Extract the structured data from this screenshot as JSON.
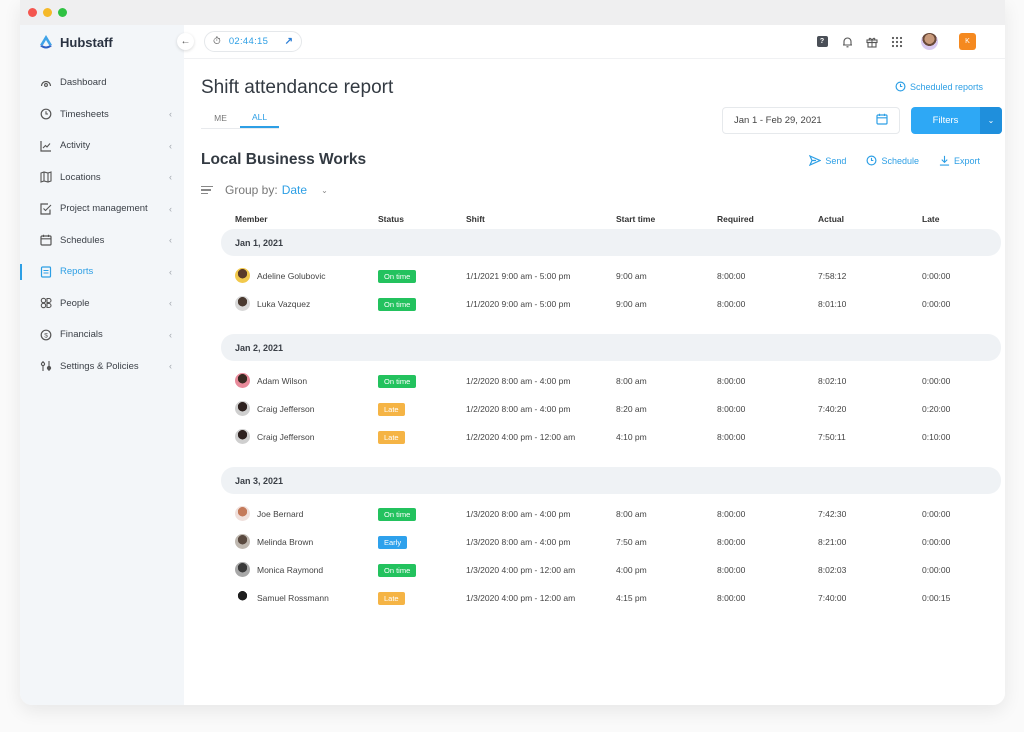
{
  "app": {
    "brand": "Hubstaff",
    "brand_color": "#2d9fe5"
  },
  "sidebar": {
    "items": [
      {
        "label": "Dashboard",
        "icon": "dashboard-icon",
        "chevron": false,
        "active": false
      },
      {
        "label": "Timesheets",
        "icon": "clock-icon",
        "chevron": true,
        "active": false
      },
      {
        "label": "Activity",
        "icon": "chart-icon",
        "chevron": true,
        "active": false
      },
      {
        "label": "Locations",
        "icon": "map-icon",
        "chevron": true,
        "active": false
      },
      {
        "label": "Project management",
        "icon": "checkbox-icon",
        "chevron": true,
        "active": false
      },
      {
        "label": "Schedules",
        "icon": "calendar-icon",
        "chevron": true,
        "active": false
      },
      {
        "label": "Reports",
        "icon": "report-icon",
        "chevron": true,
        "active": true
      },
      {
        "label": "People",
        "icon": "people-icon",
        "chevron": true,
        "active": false
      },
      {
        "label": "Financials",
        "icon": "dollar-icon",
        "chevron": true,
        "active": false
      },
      {
        "label": "Settings & Policies",
        "icon": "sliders-icon",
        "chevron": true,
        "active": false
      }
    ]
  },
  "topbar": {
    "timer_value": "02:44:15",
    "org_initial": "K",
    "help_glyph": "?"
  },
  "page": {
    "title": "Shift attendance report",
    "scheduled_reports": "Scheduled reports",
    "tabs": [
      {
        "label": "ME",
        "active": false
      },
      {
        "label": "ALL",
        "active": true
      }
    ],
    "date_range": "Jan 1 - Feb 29, 2021",
    "filters_label": "Filters",
    "org_name": "Local Business Works",
    "actions": {
      "send": "Send",
      "schedule": "Schedule",
      "export": "Export"
    },
    "group_by_label": "Group by:",
    "group_by_value": "Date"
  },
  "table": {
    "columns": [
      "Member",
      "Status",
      "Shift",
      "Start time",
      "Required",
      "Actual",
      "Late"
    ],
    "status_colors": {
      "On time": "#23c25e",
      "Late": "#f5b445",
      "Early": "#2ea1ec"
    },
    "groups": [
      {
        "date": "Jan 1, 2021",
        "rows": [
          {
            "member": "Adeline Golubovic",
            "status": "On time",
            "shift": "1/1/2021 9:00 am - 5:00 pm",
            "start": "9:00 am",
            "required": "8:00:00",
            "actual": "7:58:12",
            "late": "0:00:00"
          },
          {
            "member": "Luka Vazquez",
            "status": "On time",
            "shift": "1/1/2020 9:00 am - 5:00 pm",
            "start": "9:00 am",
            "required": "8:00:00",
            "actual": "8:01:10",
            "late": "0:00:00"
          }
        ]
      },
      {
        "date": "Jan 2, 2021",
        "rows": [
          {
            "member": "Adam Wilson",
            "status": "On time",
            "shift": "1/2/2020 8:00 am - 4:00 pm",
            "start": "8:00 am",
            "required": "8:00:00",
            "actual": "8:02:10",
            "late": "0:00:00"
          },
          {
            "member": "Craig Jefferson",
            "status": "Late",
            "shift": "1/2/2020 8:00 am - 4:00 pm",
            "start": "8:20 am",
            "required": "8:00:00",
            "actual": "7:40:20",
            "late": "0:20:00"
          },
          {
            "member": "Craig Jefferson",
            "status": "Late",
            "shift": "1/2/2020 4:00 pm - 12:00 am",
            "start": "4:10 pm",
            "required": "8:00:00",
            "actual": "7:50:11",
            "late": "0:10:00"
          }
        ]
      },
      {
        "date": "Jan 3, 2021",
        "rows": [
          {
            "member": "Joe Bernard",
            "status": "On time",
            "shift": "1/3/2020 8:00 am - 4:00 pm",
            "start": "8:00 am",
            "required": "8:00:00",
            "actual": "7:42:30",
            "late": "0:00:00"
          },
          {
            "member": "Melinda Brown",
            "status": "Early",
            "shift": "1/3/2020 8:00 am - 4:00 pm",
            "start": "7:50 am",
            "required": "8:00:00",
            "actual": "8:21:00",
            "late": "0:00:00"
          },
          {
            "member": "Monica Raymond",
            "status": "On time",
            "shift": "1/3/2020 4:00 pm - 12:00 am",
            "start": "4:00 pm",
            "required": "8:00:00",
            "actual": "8:02:03",
            "late": "0:00:00"
          },
          {
            "member": "Samuel Rossmann",
            "status": "Late",
            "shift": "1/3/2020 4:00 pm - 12:00 am",
            "start": "4:15 pm",
            "required": "8:00:00",
            "actual": "7:40:00",
            "late": "0:00:15"
          }
        ]
      }
    ]
  }
}
